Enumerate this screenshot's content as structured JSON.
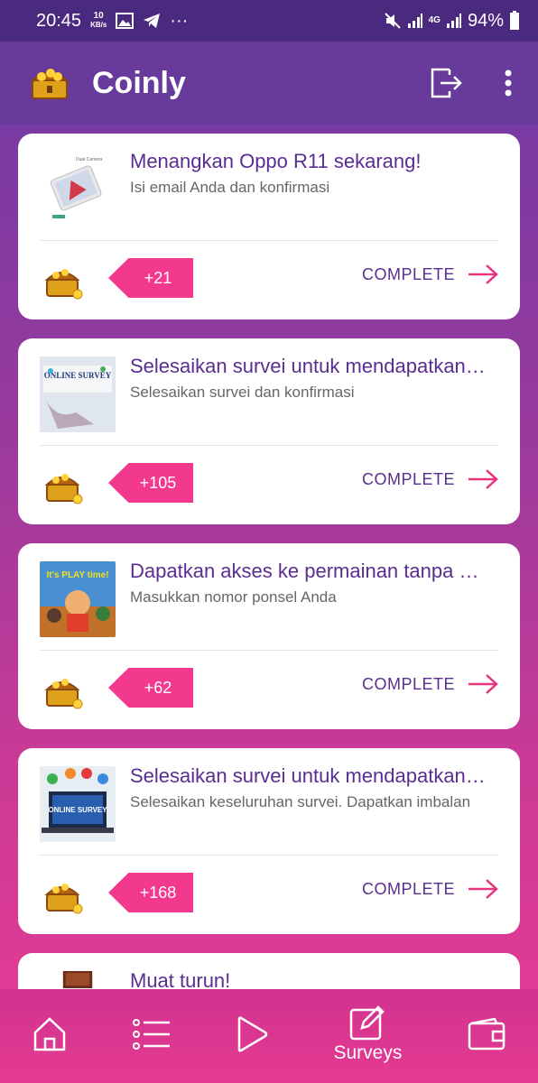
{
  "status": {
    "time": "20:45",
    "speed_top": "10",
    "speed_bottom": "KB/s",
    "more": "···",
    "network": "4G",
    "battery": "94%"
  },
  "app": {
    "title": "Coinly"
  },
  "cards": [
    {
      "title": "Menangkan Oppo R11 sekarang!",
      "subtitle": "Isi email Anda dan konfirmasi",
      "reward": "+21",
      "action": "COMPLETE",
      "thumb_text": "Dual Camera"
    },
    {
      "title": "Selesaikan survei untuk mendapatkan…",
      "subtitle": "Selesaikan survei dan konfirmasi",
      "reward": "+105",
      "action": "COMPLETE",
      "thumb_text": "ONLINE SURVEY"
    },
    {
      "title": "Dapatkan akses ke permainan tanpa …",
      "subtitle": "Masukkan nomor ponsel Anda",
      "reward": "+62",
      "action": "COMPLETE",
      "thumb_text": "It's PLAY time!"
    },
    {
      "title": "Selesaikan survei untuk mendapatkan…",
      "subtitle": "Selesaikan keseluruhan survei. Dapatkan imbalan",
      "reward": "+168",
      "action": "COMPLETE",
      "thumb_text": "ONLINE SURVEY"
    },
    {
      "title": "Muat turun!"
    }
  ],
  "nav": {
    "surveys_label": "Surveys"
  },
  "colors": {
    "accent": "#f2398e",
    "brand_purple": "#5a2d91"
  }
}
